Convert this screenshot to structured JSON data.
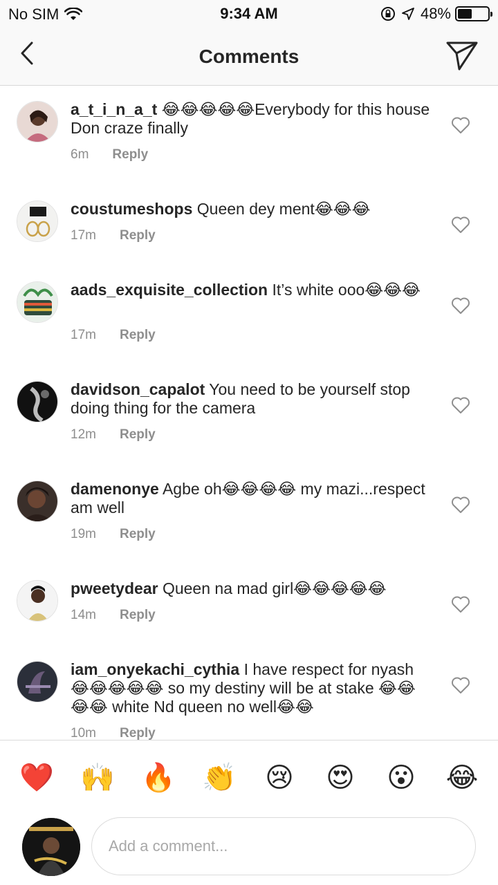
{
  "status_bar": {
    "carrier": "No SIM",
    "time": "9:34 AM",
    "battery": "48%",
    "battery_level": 0.48
  },
  "header": {
    "title": "Comments",
    "back_icon": "chevron-left-icon",
    "send_icon": "paper-plane-icon"
  },
  "comments": [
    {
      "username": "a_t_i_n_a_t",
      "text": "😂😂😂😂😂Everybody for this house Don craze finally",
      "time": "6m",
      "reply_label": "Reply"
    },
    {
      "username": "coustumeshops",
      "text": "Queen dey ment😂😂😂",
      "time": "17m",
      "reply_label": "Reply"
    },
    {
      "username": "aads_exquisite_collection",
      "text": "It’s white ooo😂😂😂",
      "time": "17m",
      "reply_label": "Reply"
    },
    {
      "username": "davidson_capalot",
      "text": "You need to be yourself stop doing thing for the camera",
      "time": "12m",
      "reply_label": "Reply"
    },
    {
      "username": "damenonye",
      "text": "Agbe oh😂😂😂😂 my mazi...respect am well",
      "time": "19m",
      "reply_label": "Reply"
    },
    {
      "username": "pweetydear",
      "text": "Queen na mad girl😂😂😂😂😂",
      "time": "14m",
      "reply_label": "Reply"
    },
    {
      "username": "iam_onyekachi_cythia",
      "text": "I have respect for nyash 😂😂😂😂😂 so my destiny will be at stake 😂😂😂😂 white Nd queen no well😂😂",
      "time": "10m",
      "reply_label": "Reply"
    }
  ],
  "reactions": [
    "❤️",
    "🙌",
    "🔥",
    "👏",
    "😢",
    "😍",
    "😮",
    "😂"
  ],
  "composer": {
    "placeholder": "Add a comment..."
  },
  "colors": {
    "text": "#262626",
    "meta": "#8e8e8e",
    "divider": "#dbdbdb",
    "header_bg": "#f9f9f9"
  }
}
